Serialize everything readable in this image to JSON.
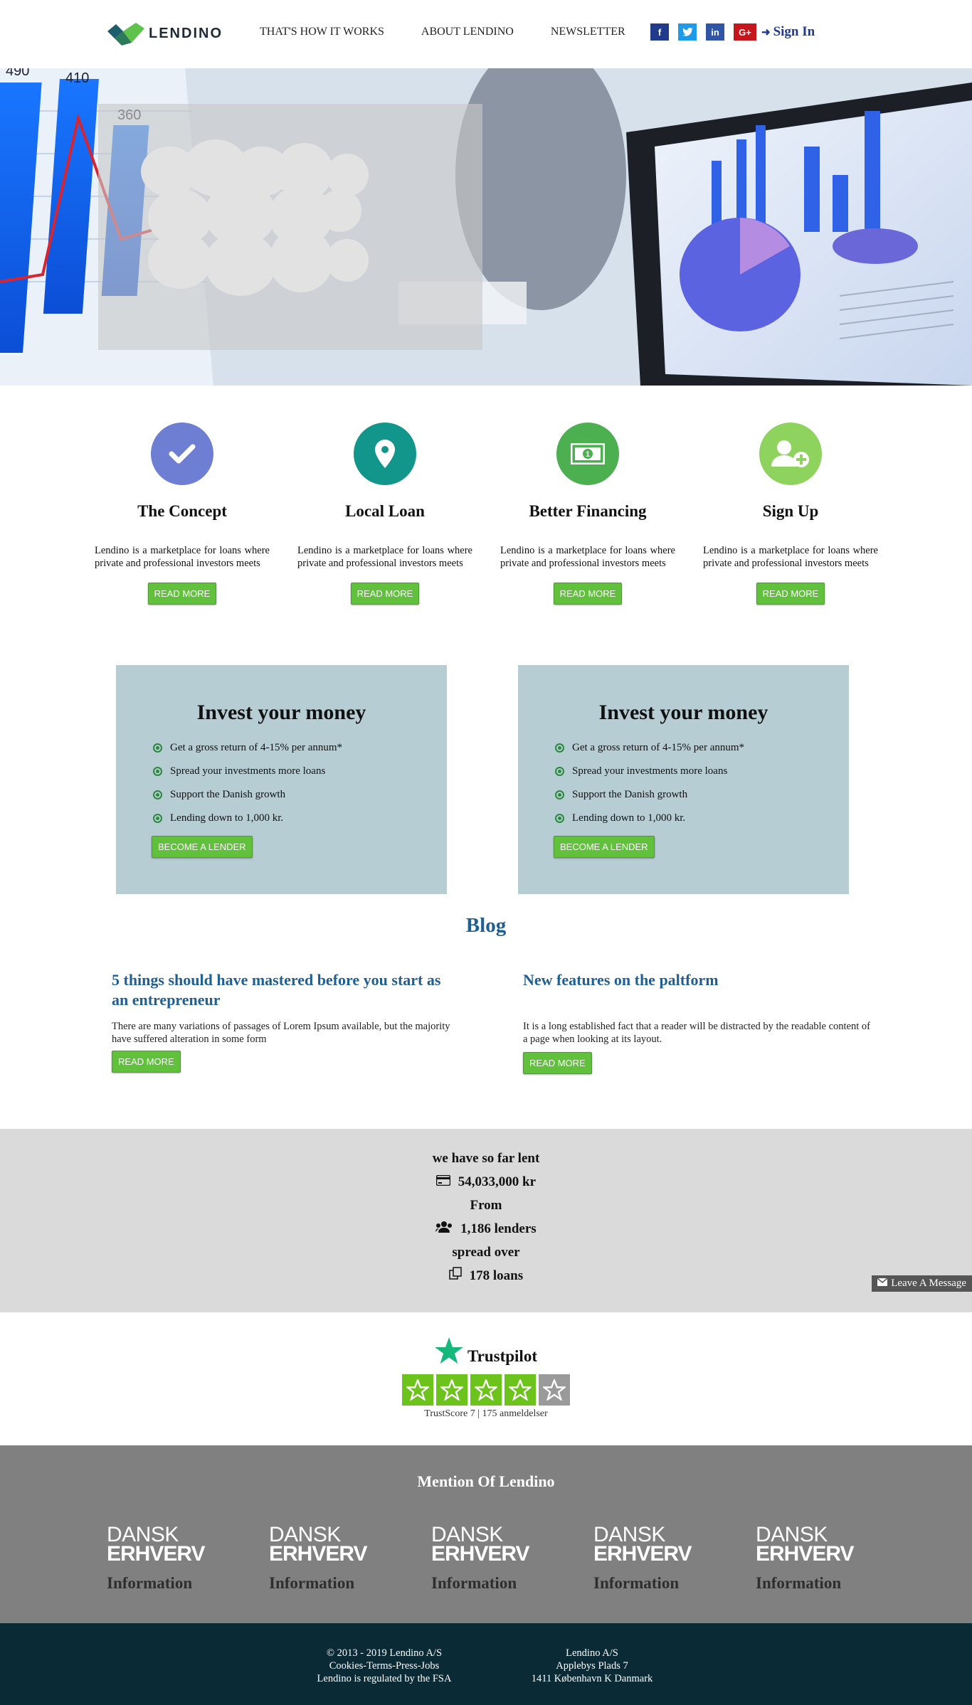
{
  "header": {
    "brand": "LENDINO",
    "nav": [
      "THAT'S HOW IT WORKS",
      "ABOUT LENDINO",
      "NEWSLETTER"
    ],
    "social": [
      {
        "icon": "facebook-icon",
        "glyph": "f"
      },
      {
        "icon": "twitter-icon",
        "glyph": "t"
      },
      {
        "icon": "linkedin-icon",
        "glyph": "in"
      },
      {
        "icon": "google-plus-icon",
        "glyph": "G+"
      }
    ],
    "signin": "Sign In"
  },
  "colors": {
    "brand_green": "#61c13c",
    "blog_blue": "#1e5f94",
    "invest_bg": "#b7cdd4",
    "footer_bg": "#0a2a36"
  },
  "features": [
    {
      "title": "The Concept",
      "icon": "check-icon",
      "color": "#6e7ed3",
      "text": "Lendino is a marketplace for loans where private and professional investors meets",
      "button": "READ MORE"
    },
    {
      "title": "Local Loan",
      "icon": "map-pin-icon",
      "color": "#12958a",
      "text": "Lendino is a marketplace for loans where private and professional investors meets",
      "button": "READ MORE"
    },
    {
      "title": "Better Financing",
      "icon": "banknote-icon",
      "color": "#4caf50",
      "text": "Lendino is a marketplace for loans where private and professional investors meets",
      "button": "READ MORE"
    },
    {
      "title": "Sign Up",
      "icon": "user-plus-icon",
      "color": "#8ed35d",
      "text": "Lendino is a marketplace for loans where private and professional investors meets",
      "button": "READ MORE"
    }
  ],
  "invest": [
    {
      "title": "Invest your money",
      "items": [
        "Get a gross return of 4-15% per annum*",
        "Spread your investments more loans",
        "Support the Danish growth",
        "Lending down to 1,000 kr."
      ],
      "button": "BECOME A LENDER"
    },
    {
      "title": "Invest your money",
      "items": [
        "Get a gross return of 4-15% per annum*",
        "Spread your investments more loans",
        "Support the Danish growth",
        "Lending down to 1,000 kr."
      ],
      "button": "BECOME A LENDER"
    }
  ],
  "blog": {
    "title": "Blog",
    "posts": [
      {
        "title": "5 things should have mastered before you start as an entrepreneur",
        "text": "There are many variations of passages of Lorem Ipsum available, but the majority have suffered alteration in some form",
        "button": "READ MORE"
      },
      {
        "title": "New features on the paltform",
        "text": "It is a long established fact that a reader will be distracted by the readable content of a page when looking at its layout.",
        "button": "READ MORE"
      }
    ]
  },
  "stats": {
    "line1": "we have so far lent",
    "amount": "54,033,000 kr",
    "line2": "From",
    "lenders": "1,186 lenders",
    "line3": "spread over",
    "loans": "178 loans",
    "leave_message": "Leave A Message"
  },
  "trustpilot": {
    "name": "Trustpilot",
    "stars_filled": 4,
    "stars_total": 5,
    "score_label": "TrustScore",
    "score": "7",
    "reviews": "175 anmeldelser"
  },
  "mentions": {
    "title": "Mention Of Lendino",
    "items": [
      {
        "top": "DANSK",
        "bottom": "ERHVERV",
        "pub": "Information"
      },
      {
        "top": "DANSK",
        "bottom": "ERHVERV",
        "pub": "Information"
      },
      {
        "top": "DANSK",
        "bottom": "ERHVERV",
        "pub": "Information"
      },
      {
        "top": "DANSK",
        "bottom": "ERHVERV",
        "pub": "Information"
      },
      {
        "top": "DANSK",
        "bottom": "ERHVERV",
        "pub": "Information"
      }
    ]
  },
  "footer": {
    "left": [
      "© 2013 - 2019 Lendino A/S",
      "Cookies-Terms-Press-Jobs",
      "Lendino is regulated by the FSA"
    ],
    "right": [
      "Lendino A/S",
      "Applebys Plads 7",
      "1411 København K Danmark"
    ]
  }
}
